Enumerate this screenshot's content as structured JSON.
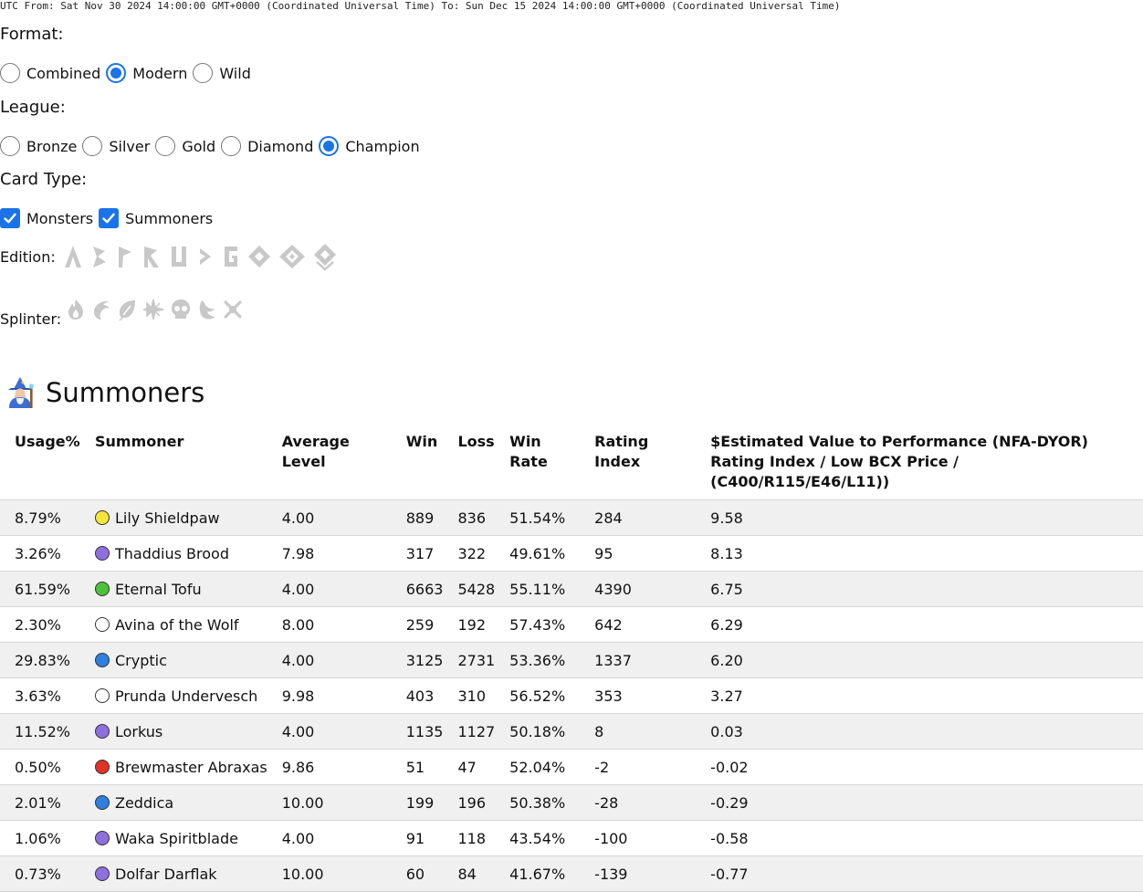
{
  "date_range": "UTC From: Sat Nov 30 2024 14:00:00 GMT+0000 (Coordinated Universal Time) To: Sun Dec 15 2024 14:00:00 GMT+0000 (Coordinated Universal Time)",
  "format": {
    "label": "Format:",
    "options": [
      {
        "label": "Combined",
        "checked": false
      },
      {
        "label": "Modern",
        "checked": true
      },
      {
        "label": "Wild",
        "checked": false
      }
    ]
  },
  "league": {
    "label": "League:",
    "options": [
      {
        "label": "Bronze",
        "checked": false
      },
      {
        "label": "Silver",
        "checked": false
      },
      {
        "label": "Gold",
        "checked": false
      },
      {
        "label": "Diamond",
        "checked": false
      },
      {
        "label": "Champion",
        "checked": true
      }
    ]
  },
  "card_type": {
    "label": "Card Type:",
    "options": [
      {
        "label": "Monsters",
        "checked": true
      },
      {
        "label": "Summoners",
        "checked": true
      }
    ]
  },
  "edition": {
    "label": "Edition:",
    "icons": [
      "alpha-edition-icon",
      "beta-edition-icon",
      "promo-edition-icon",
      "reward-edition-icon",
      "untamed-edition-icon",
      "dice-edition-icon",
      "chaos-edition-icon",
      "rebellion-edition-icon",
      "soulbound-edition-icon",
      "conclave-edition-icon"
    ]
  },
  "splinter": {
    "label": "Splinter:",
    "icons": [
      "fire-splinter-icon",
      "water-splinter-icon",
      "earth-splinter-icon",
      "life-splinter-icon",
      "death-splinter-icon",
      "dragon-splinter-icon",
      "neutral-splinter-icon"
    ]
  },
  "summoners": {
    "title": "Summoners",
    "icon": "wizard-icon",
    "columns": {
      "usage": "Usage%",
      "summoner": "Summoner",
      "avg_level": "Average Level",
      "win": "Win",
      "loss": "Loss",
      "win_rate": "Win Rate",
      "rating_index": "Rating Index",
      "value_line1": "$Estimated Value to Performance (NFA-DYOR)",
      "value_line2": "Rating Index / Low BCX Price / (C400/R115/E46/L11))"
    },
    "rows": [
      {
        "usage": "8.79%",
        "name": "Lily Shieldpaw",
        "color": "#f5e63a",
        "avg_level": "4.00",
        "win": "889",
        "loss": "836",
        "win_rate": "51.54%",
        "rating_index": "284",
        "value": "9.58"
      },
      {
        "usage": "3.26%",
        "name": "Thaddius Brood",
        "color": "#8e6fe0",
        "avg_level": "7.98",
        "win": "317",
        "loss": "322",
        "win_rate": "49.61%",
        "rating_index": "95",
        "value": "8.13"
      },
      {
        "usage": "61.59%",
        "name": "Eternal Tofu",
        "color": "#4cc13a",
        "avg_level": "4.00",
        "win": "6663",
        "loss": "5428",
        "win_rate": "55.11%",
        "rating_index": "4390",
        "value": "6.75"
      },
      {
        "usage": "2.30%",
        "name": "Avina of the Wolf",
        "color": "#ffffff",
        "avg_level": "8.00",
        "win": "259",
        "loss": "192",
        "win_rate": "57.43%",
        "rating_index": "642",
        "value": "6.29"
      },
      {
        "usage": "29.83%",
        "name": "Cryptic",
        "color": "#2f7fe0",
        "avg_level": "4.00",
        "win": "3125",
        "loss": "2731",
        "win_rate": "53.36%",
        "rating_index": "1337",
        "value": "6.20"
      },
      {
        "usage": "3.63%",
        "name": "Prunda Undervesch",
        "color": "#ffffff",
        "avg_level": "9.98",
        "win": "403",
        "loss": "310",
        "win_rate": "56.52%",
        "rating_index": "353",
        "value": "3.27"
      },
      {
        "usage": "11.52%",
        "name": "Lorkus",
        "color": "#8e6fe0",
        "avg_level": "4.00",
        "win": "1135",
        "loss": "1127",
        "win_rate": "50.18%",
        "rating_index": "8",
        "value": "0.03"
      },
      {
        "usage": "0.50%",
        "name": "Brewmaster Abraxas",
        "color": "#e03226",
        "avg_level": "9.86",
        "win": "51",
        "loss": "47",
        "win_rate": "52.04%",
        "rating_index": "-2",
        "value": "-0.02"
      },
      {
        "usage": "2.01%",
        "name": "Zeddica",
        "color": "#2f7fe0",
        "avg_level": "10.00",
        "win": "199",
        "loss": "196",
        "win_rate": "50.38%",
        "rating_index": "-28",
        "value": "-0.29"
      },
      {
        "usage": "1.06%",
        "name": "Waka Spiritblade",
        "color": "#8e6fe0",
        "avg_level": "4.00",
        "win": "91",
        "loss": "118",
        "win_rate": "43.54%",
        "rating_index": "-100",
        "value": "-0.58"
      },
      {
        "usage": "0.73%",
        "name": "Dolfar Darflak",
        "color": "#8e6fe0",
        "avg_level": "10.00",
        "win": "60",
        "loss": "84",
        "win_rate": "41.67%",
        "rating_index": "-139",
        "value": "-0.77"
      }
    ]
  }
}
